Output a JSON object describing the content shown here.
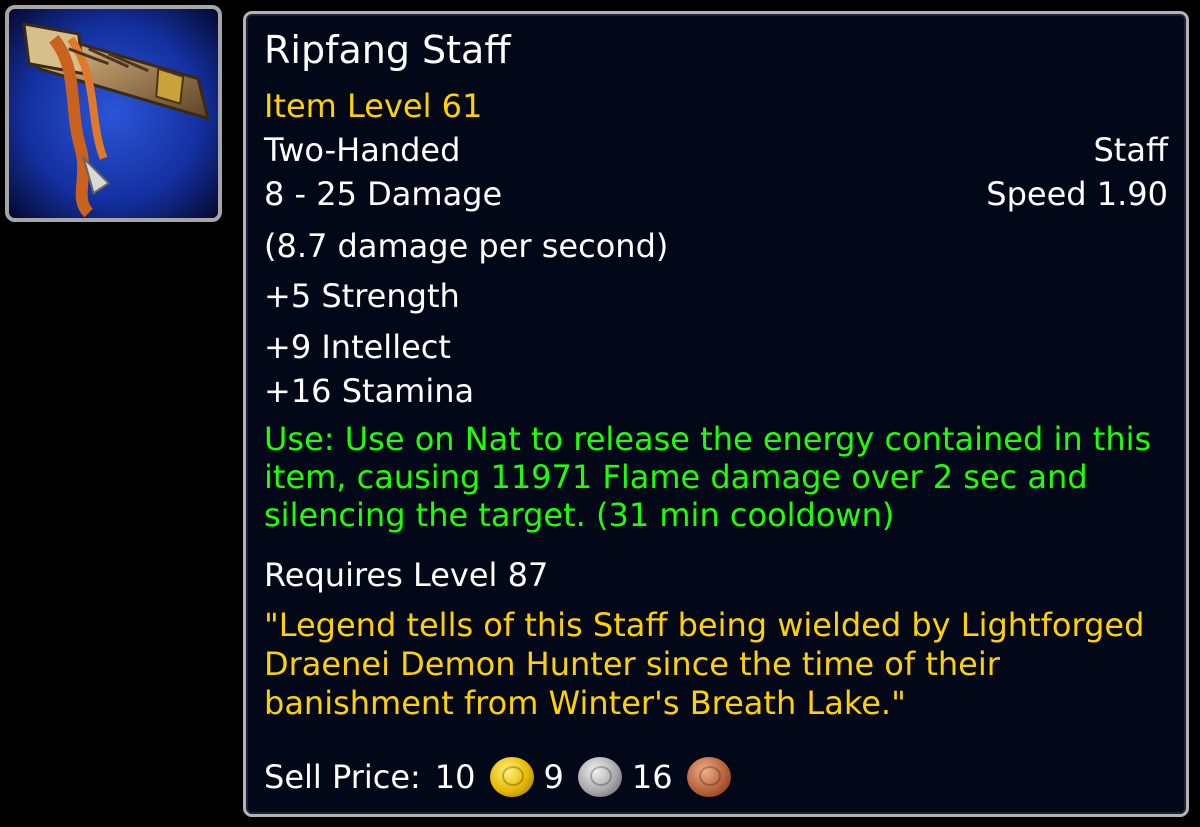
{
  "item": {
    "icon": "staff-item-icon",
    "name": "Ripfang Staff",
    "item_level": "Item Level 61",
    "slot": "Two-Handed",
    "type": "Staff",
    "damage": "8 - 25 Damage",
    "speed": "Speed 1.90",
    "dps": "(8.7 damage per second)",
    "stats": [
      "+5 Strength",
      "+9 Intellect",
      "+16 Stamina"
    ],
    "use_effect": "Use: Use on Nat to release the energy contained in this item, causing 11971 Flame damage over 2 sec and silencing the target. (31 min cooldown)",
    "requirement": "Requires Level 87",
    "flavor_text": "\"Legend tells of this Staff being wielded by Lightforged Draenei Demon Hunter since the time of their banishment from Winter's Breath Lake.\"",
    "sell_price": {
      "label": "Sell Price:",
      "gold": "10",
      "silver": "9",
      "copper": "16"
    }
  },
  "colors": {
    "title": "#ffffff",
    "item_level": "#ffd100",
    "use_effect": "#1eff00",
    "flavor_text": "#ffd100",
    "background": "#030818",
    "border": "#b3b3b3"
  }
}
